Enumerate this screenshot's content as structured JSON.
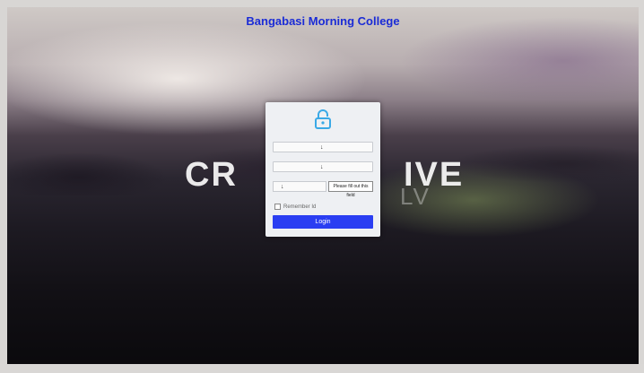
{
  "page": {
    "college_title": "Bangabasi Morning College",
    "watermark_left": "CR",
    "watermark_right": "IVE",
    "watermark_ghost": "LV"
  },
  "login_form": {
    "lock_icon": "lock-icon",
    "username_marker": "↓",
    "password_marker": "↓",
    "captcha_marker": "↓",
    "captcha_text": "Please fill out this field",
    "remember_label": "Remember Id",
    "login_label": "Login"
  },
  "colors": {
    "title": "#1a2bd6",
    "button": "#2a3ef2",
    "card": "#eef0f3"
  }
}
